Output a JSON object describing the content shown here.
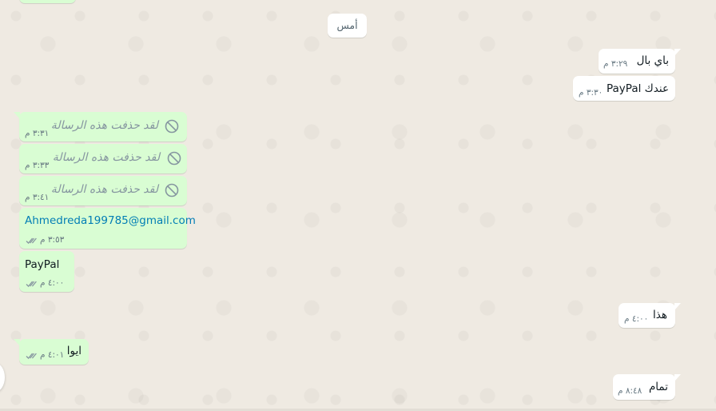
{
  "date_chip": "أمس",
  "incoming": [
    {
      "text": "باي بال",
      "time": "٣:٢٩ م"
    },
    {
      "text": "عندك PayPal",
      "time": "٣:٣٠ م"
    },
    {
      "text": "هذا",
      "time": "٤:٠٠ م"
    },
    {
      "text": "تمام",
      "time": "٨:٤٨ م"
    }
  ],
  "outgoing": [
    {
      "deleted_text": "لقد حذفت هذه الرسالة",
      "time": "٣:٣١ م"
    },
    {
      "deleted_text": "لقد حذفت هذه الرسالة",
      "time": "٣:٣٣ م"
    },
    {
      "deleted_text": "لقد حذفت هذه الرسالة",
      "time": "٣:٤١ م"
    },
    {
      "link": "Ahmedreda199785@gmail.com",
      "time": "٣:٥٣ م"
    },
    {
      "text": "PayPal",
      "time": "٤:٠٠ م"
    },
    {
      "text": "ايوا",
      "time": "٤:٠١ م"
    }
  ],
  "colors": {
    "background": "#efeae2",
    "incoming_bubble": "#ffffff",
    "outgoing_bubble": "#d9fdd3",
    "read_ticks": "#8696a0",
    "link": "#027eb5"
  }
}
